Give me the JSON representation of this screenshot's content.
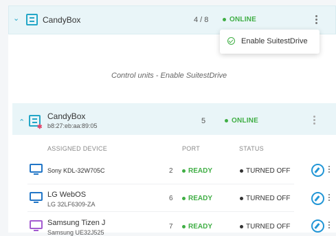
{
  "top_box": {
    "title": "CandyBox",
    "count": "4 / 8",
    "status": "ONLINE"
  },
  "menu": {
    "item_label": "Enable SuitestDrive"
  },
  "empty_message": "Control units - Enable SuitestDrive",
  "unit": {
    "title": "CandyBox",
    "mac": "b8:27:eb:aa:89:05",
    "port_count": "5",
    "status": "ONLINE"
  },
  "table": {
    "headers": {
      "device": "ASSIGNED DEVICE",
      "port": "PORT",
      "status": "STATUS"
    },
    "rows": [
      {
        "name": "Sony KDL-32W705C",
        "model": "",
        "port": "2",
        "state": "READY",
        "power": "TURNED OFF"
      },
      {
        "name": "LG WebOS",
        "model": "LG 32LF6309-ZA",
        "port": "6",
        "state": "READY",
        "power": "TURNED OFF"
      },
      {
        "name": "Samsung Tizen J",
        "model": "Samsung UE32J525",
        "port": "7",
        "state": "READY",
        "power": "TURNED OFF"
      }
    ]
  },
  "colors": {
    "accent": "#23a6c7",
    "online": "#3fae44",
    "edit": "#2296d6",
    "purple": "#a35bd0"
  },
  "icons": [
    "chevron-down-icon",
    "control-box-icon",
    "kebab-menu-icon",
    "check-circle-icon",
    "chevron-up-icon",
    "tv-icon",
    "edit-icon"
  ]
}
